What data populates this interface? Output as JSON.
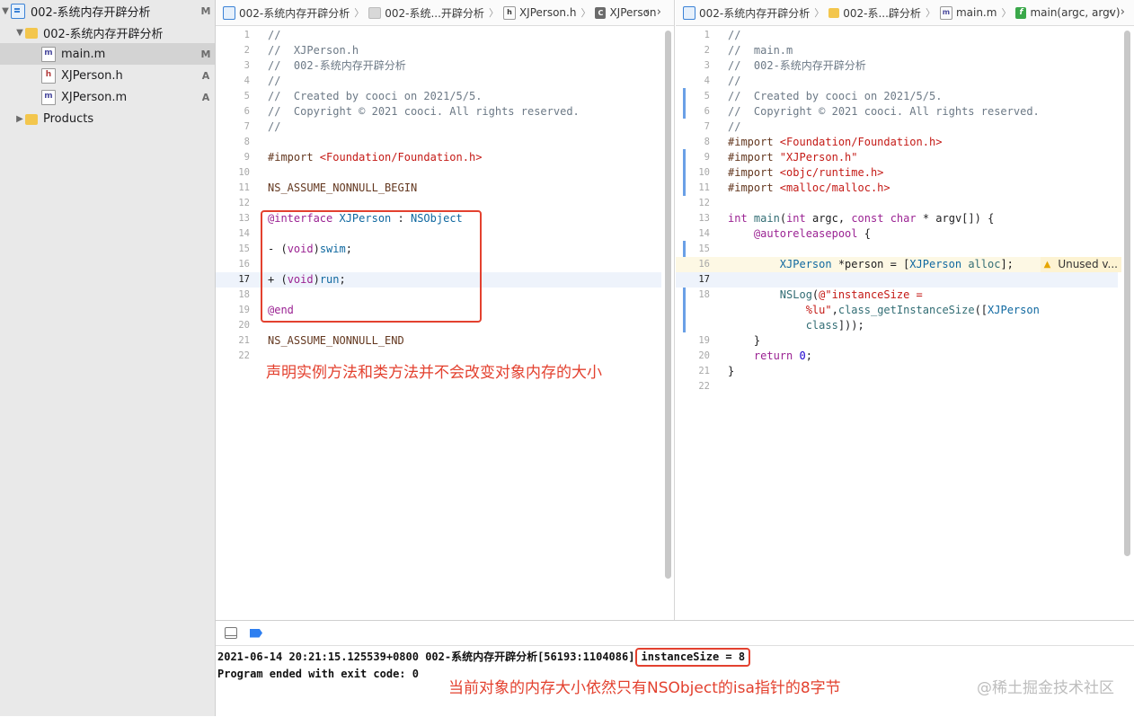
{
  "navigator": {
    "items": [
      {
        "label": "002-系统内存开辟分析",
        "badge": "M",
        "icon": "project-icon"
      },
      {
        "label": "002-系统内存开辟分析",
        "badge": "",
        "icon": "folder-icon"
      },
      {
        "label": "main.m",
        "badge": "M",
        "icon": "m-file-icon"
      },
      {
        "label": "XJPerson.h",
        "badge": "A",
        "icon": "h-file-icon"
      },
      {
        "label": "XJPerson.m",
        "badge": "A",
        "icon": "m-file-icon"
      },
      {
        "label": "Products",
        "badge": "",
        "icon": "folder-icon"
      }
    ]
  },
  "left_editor": {
    "breadcrumbs": [
      "002-系统内存开辟分析",
      "002-系统...开辟分析",
      "XJPerson.h",
      "XJPerson"
    ],
    "annotation": "声明实例方法和类方法并不会改变对象内存的大小"
  },
  "right_editor": {
    "breadcrumbs": [
      "002-系统内存开辟分析",
      "002-系...辟分析",
      "main.m",
      "main(argc, argv)"
    ],
    "warning": "Unused v..."
  },
  "console": {
    "line1_prefix": "2021-06-14 20:21:15.125539+0800 002-系统内存开辟分析[56193:1104086]",
    "line1_highlight": "instanceSize = 8",
    "line2": "Program ended with exit code: 0",
    "annotation": "当前对象的内存大小依然只有NSObject的isa指针的8字节"
  },
  "watermark": "@稀土掘金技术社区"
}
